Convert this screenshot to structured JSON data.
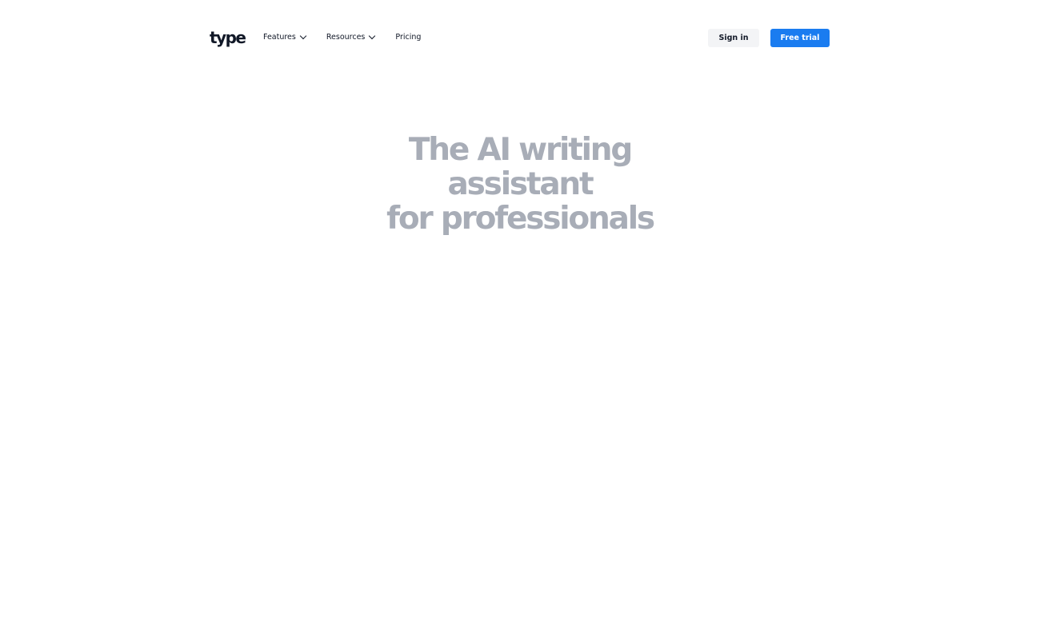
{
  "nav": {
    "logo": "type",
    "links": [
      {
        "label": "Features",
        "has_dropdown": true
      },
      {
        "label": "Resources",
        "has_dropdown": true
      },
      {
        "label": "Pricing",
        "has_dropdown": false
      }
    ],
    "signin_label": "Sign in",
    "trial_label": "Free trial"
  },
  "hero": {
    "headline_line1": "The AI writing assistant",
    "headline_line2": "for professionals"
  },
  "colors": {
    "accent": "#1a7cf0",
    "text_dark": "#111827",
    "headline_faded": "#a8adb7"
  },
  "icons": {
    "dropdown": "chevron-down-icon"
  }
}
